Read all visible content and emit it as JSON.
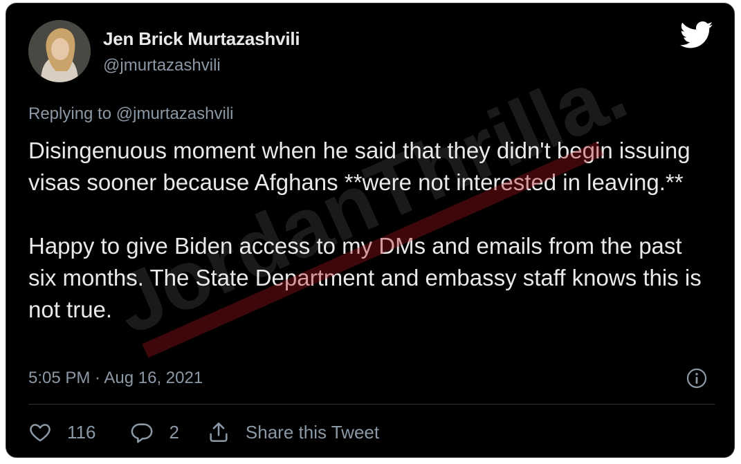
{
  "author": {
    "name": "Jen Brick Murtazashvili",
    "handle": "@jmurtazashvili"
  },
  "reply": {
    "prefix": "Replying to ",
    "mention": "@jmurtazashvili"
  },
  "tweet": {
    "paragraph_1": "Disingenuous moment when he said that they didn't begin issuing visas sooner because Afghans **were not interested in leaving.**",
    "paragraph_2": "Happy to give Biden access to my DMs and emails from the past six months.  The State Department and embassy staff knows this is not true."
  },
  "meta": {
    "time": "5:05 PM",
    "separator": " · ",
    "date": "Aug 16, 2021"
  },
  "actions": {
    "likes": "116",
    "replies": "2",
    "share_label": "Share this Tweet"
  },
  "watermark": {
    "text": "JordanThrilla."
  },
  "icons": {
    "brand": "twitter-bird-icon",
    "info": "info-icon",
    "like": "heart-icon",
    "reply": "reply-bubble-icon",
    "share": "share-icon"
  },
  "colors": {
    "background": "#000000",
    "primary_text": "#e7e9ea",
    "secondary_text": "#8b98a5",
    "divider": "#2f3336"
  }
}
